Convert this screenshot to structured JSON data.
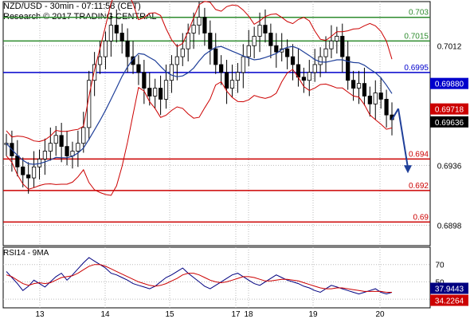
{
  "header": {
    "title": "NZD/USD - 30min - 07:11:58 (CET)",
    "subtitle": "Research © 2017 TRADING CENTRAL"
  },
  "rsi": {
    "label": "RSI14 - 9MA"
  },
  "chart_data": [
    {
      "type": "candlestick",
      "title": "NZD/USD - 30min - 07:11:58 (CET)",
      "ylim": [
        0.6885,
        0.704
      ],
      "y_ticks": [
        {
          "value": 0.7012,
          "label": "0.7012"
        },
        {
          "value": 0.6936,
          "label": "0.6936"
        },
        {
          "value": 0.6898,
          "label": "0.6898"
        }
      ],
      "x_ticks": [
        "13",
        "14",
        "15",
        "17",
        "18",
        "19",
        "20"
      ],
      "grid": true,
      "price_tags": [
        {
          "value": 0.6988,
          "label": "0.69880",
          "color": "#0000cc"
        },
        {
          "value": 0.69718,
          "label": "0.69718",
          "color": "#cc0000"
        },
        {
          "value": 0.69636,
          "label": "0.69636",
          "color": "#000000"
        }
      ],
      "levels": [
        {
          "value": 0.703,
          "label": "0.703",
          "color": "#2e8b2e"
        },
        {
          "value": 0.7015,
          "label": "0.7015",
          "color": "#2e8b2e"
        },
        {
          "value": 0.6995,
          "label": "0.6995",
          "color": "#0000cc"
        },
        {
          "value": 0.694,
          "label": "0.694",
          "color": "#cc0000"
        },
        {
          "value": 0.692,
          "label": "0.692",
          "color": "#cc0000"
        },
        {
          "value": 0.69,
          "label": "0.69",
          "color": "#cc0000"
        }
      ],
      "close_path": [
        0.695,
        0.6942,
        0.6935,
        0.693,
        0.6928,
        0.6935,
        0.694,
        0.6945,
        0.695,
        0.6955,
        0.6948,
        0.6942,
        0.6945,
        0.695,
        0.696,
        0.699,
        0.7,
        0.7005,
        0.7015,
        0.7025,
        0.702,
        0.7015,
        0.7005,
        0.7,
        0.6995,
        0.6985,
        0.698,
        0.6985,
        0.6978,
        0.699,
        0.7,
        0.7005,
        0.701,
        0.702,
        0.7025,
        0.703,
        0.702,
        0.701,
        0.7,
        0.6995,
        0.6985,
        0.699,
        0.6995,
        0.7005,
        0.7012,
        0.7018,
        0.7025,
        0.702,
        0.7012,
        0.7008,
        0.701,
        0.7005,
        0.7,
        0.6992,
        0.699,
        0.6995,
        0.7,
        0.7005,
        0.701,
        0.7015,
        0.7018,
        0.7005,
        0.699,
        0.6985,
        0.6988,
        0.698,
        0.6975,
        0.6982,
        0.6978,
        0.6968,
        0.6965
      ],
      "forecast": {
        "from": 0.6972,
        "to": 0.6932,
        "color": "#1f3f99"
      }
    },
    {
      "type": "line",
      "title": "RSI14 - 9MA",
      "ylim": [
        20,
        90
      ],
      "y_ticks": [
        70,
        50,
        30
      ],
      "values_label": {
        "value": 37.9443,
        "label": "37.9443"
      },
      "ma_label": {
        "value": 34.2264,
        "label": "34.2264"
      },
      "series": [
        {
          "color": "#000080",
          "values": [
            62,
            55,
            48,
            40,
            45,
            52,
            48,
            44,
            50,
            56,
            60,
            52,
            58,
            65,
            72,
            78,
            74,
            70,
            66,
            60,
            58,
            55,
            52,
            48,
            46,
            44,
            42,
            45,
            50,
            55,
            58,
            62,
            66,
            60,
            55,
            50,
            45,
            42,
            46,
            50,
            54,
            58,
            60,
            56,
            52,
            48,
            46,
            50,
            54,
            58,
            55,
            52,
            50,
            48,
            45,
            43,
            40,
            38,
            42,
            46,
            44,
            42,
            40,
            38,
            36,
            38,
            40,
            42,
            38,
            36,
            38
          ]
        },
        {
          "color": "#cc0000",
          "values": [
            58,
            56,
            52,
            48,
            46,
            48,
            49,
            48,
            49,
            52,
            55,
            56,
            57,
            60,
            64,
            68,
            70,
            70,
            68,
            65,
            62,
            59,
            56,
            53,
            50,
            48,
            46,
            45,
            46,
            48,
            51,
            54,
            58,
            60,
            60,
            58,
            55,
            52,
            50,
            49,
            50,
            52,
            54,
            56,
            56,
            55,
            53,
            51,
            51,
            52,
            53,
            53,
            52,
            51,
            49,
            47,
            45,
            43,
            42,
            42,
            43,
            43,
            42,
            41,
            40,
            39,
            39,
            39,
            39,
            38,
            38
          ]
        }
      ]
    }
  ]
}
